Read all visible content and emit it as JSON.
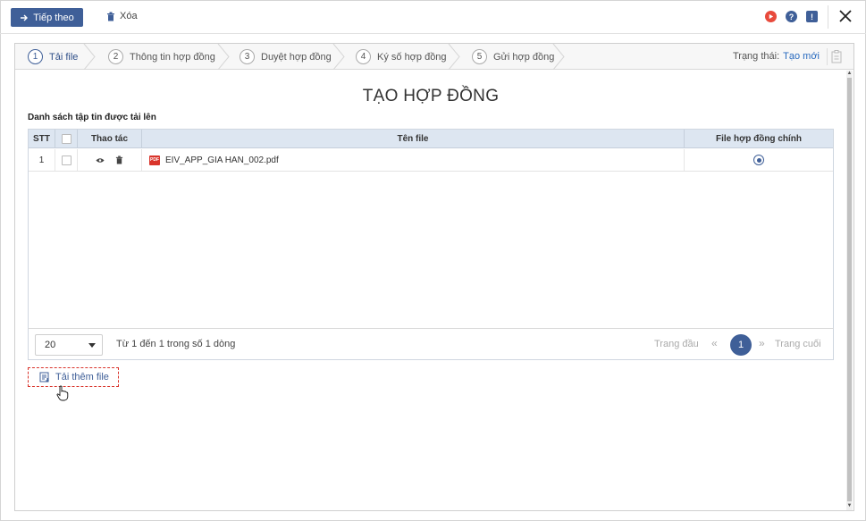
{
  "toolbar": {
    "next_label": "Tiếp theo",
    "delete_label": "Xóa"
  },
  "steps": [
    {
      "num": "1",
      "label": "Tải file",
      "active": true
    },
    {
      "num": "2",
      "label": "Thông tin hợp đồng",
      "active": false
    },
    {
      "num": "3",
      "label": "Duyệt hợp đồng",
      "active": false
    },
    {
      "num": "4",
      "label": "Ký số hợp đồng",
      "active": false
    },
    {
      "num": "5",
      "label": "Gửi hợp đồng",
      "active": false
    }
  ],
  "status": {
    "label": "Trạng thái:",
    "value": "Tạo mới"
  },
  "page": {
    "title": "TẠO HỢP ĐỒNG",
    "list_label": "Danh sách tập tin được tải lên"
  },
  "table": {
    "headers": {
      "stt": "STT",
      "actions": "Thao tác",
      "filename": "Tên file",
      "main_file": "File hợp đồng chính"
    },
    "rows": [
      {
        "stt": "1",
        "filename": "EIV_APP_GIA HAN_002.pdf",
        "file_type": "PDF",
        "is_main": true
      }
    ]
  },
  "pager": {
    "page_size": "20",
    "range_text": "Từ 1 đến 1 trong số 1 dòng",
    "first_label": "Trang đầu",
    "prev_symbol": "«",
    "current_page": "1",
    "next_symbol": "»",
    "last_label": "Trang cuối"
  },
  "add_file_label": "Tải thêm file",
  "colors": {
    "primary": "#3f5f98",
    "header_bg": "#dde6f1",
    "pdf_red": "#d9342b",
    "status_blue": "#2a6bbf",
    "video_red": "#e84a3c"
  },
  "icons": {
    "next": "arrow-right-icon",
    "delete": "trash-icon",
    "video": "video-play-icon",
    "help": "help-icon",
    "feedback": "feedback-icon",
    "close": "close-icon",
    "view": "eye-icon",
    "file": "pdf-icon",
    "add": "upload-file-icon",
    "cursor": "hand-cursor-icon"
  }
}
